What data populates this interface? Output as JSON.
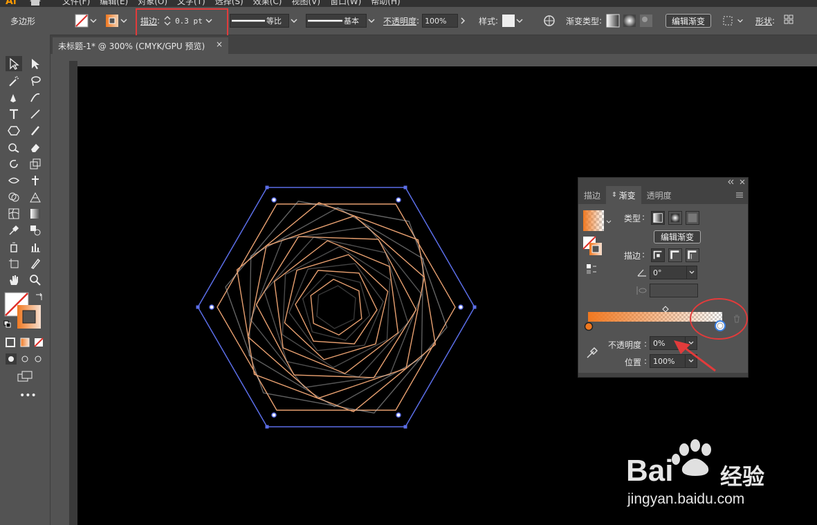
{
  "app": {
    "logo": "Ai"
  },
  "menu": [
    "文件(F)",
    "编辑(E)",
    "对象(O)",
    "文字(T)",
    "选择(S)",
    "效果(C)",
    "视图(V)",
    "窗口(W)",
    "帮助(H)"
  ],
  "control": {
    "tool_name": "多边形",
    "stroke_label": "描边",
    "stroke_value": "0.3 pt",
    "profile_label": "等比",
    "brush_label": "基本",
    "opacity_label": "不透明度",
    "opacity_value": "100%",
    "style_label": "样式",
    "gradient_type_label": "渐变类型",
    "edit_gradient_label": "编辑渐变",
    "shape_label": "形状"
  },
  "document": {
    "tab_title": "未标题-1* @ 300% (CMYK/GPU 预览)",
    "close": "×"
  },
  "panel": {
    "tabs": [
      "描边",
      "渐变",
      "透明度"
    ],
    "active_tab": "渐变",
    "type_label": "类型",
    "edit_gradient_label": "编辑渐变",
    "stroke_label": "描边",
    "angle_value": "0°",
    "opacity_label": "不透明度",
    "opacity_value": "0%",
    "position_label": "位置",
    "position_value": "100%"
  },
  "watermark": {
    "brand": "Bai",
    "brand2": "经验",
    "url": "jingyan.baidu.com"
  },
  "colors": {
    "gradient_start": "#f07820",
    "stroke": "#e8a070",
    "selection": "#5b6ee8",
    "annotation": "#e23b3b"
  }
}
